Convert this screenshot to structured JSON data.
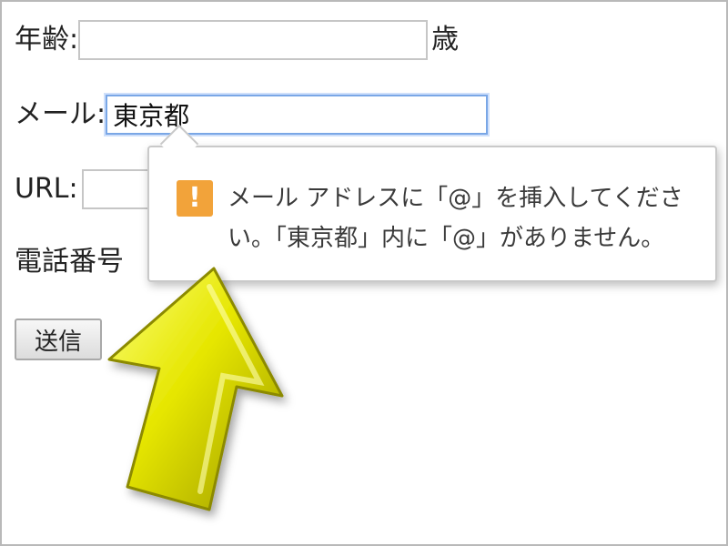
{
  "form": {
    "age": {
      "label": "年齢:",
      "value": "",
      "suffix": "歳"
    },
    "email": {
      "label": "メール:",
      "value": "東京都"
    },
    "url": {
      "label": "URL:",
      "value": ""
    },
    "phone": {
      "label": "電話番号"
    },
    "submit_label": "送信"
  },
  "validation_bubble": {
    "icon": "warning-icon",
    "icon_glyph": "!",
    "line1": "メール アドレスに「@」を挿入してくださ",
    "line2": "い。「東京都」内に「@」がありません。"
  },
  "colors": {
    "warning": "#f2a33a",
    "focus_border": "#7aa7e6",
    "arrow": "#e6e600"
  }
}
